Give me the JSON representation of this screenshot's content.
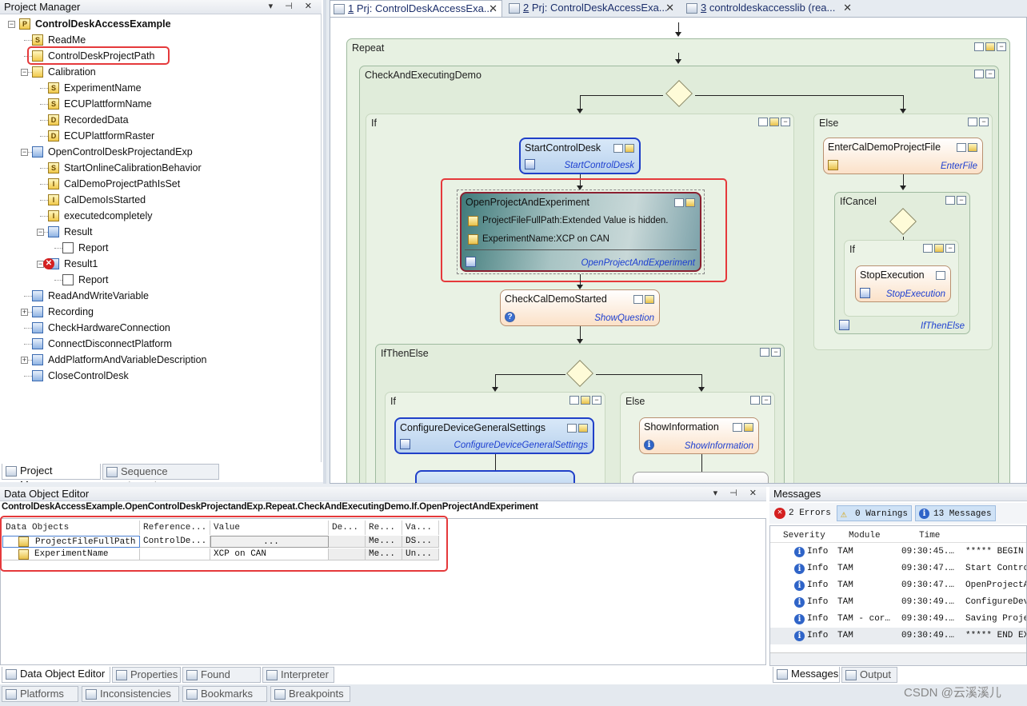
{
  "project_manager": {
    "title": "Project Manager",
    "pin_controls": "▾ ⊣ ✕",
    "tree": [
      {
        "label": "ControlDeskAccessExample",
        "bold": true,
        "icon": "project-icon",
        "depth": 0
      },
      {
        "label": "ReadMe",
        "icon": "string-icon",
        "depth": 1
      },
      {
        "label": "ControlDeskProjectPath",
        "icon": "file-icon",
        "depth": 1
      },
      {
        "label": "Calibration",
        "icon": "database-icon",
        "depth": 1
      },
      {
        "label": "ExperimentName",
        "icon": "string-icon",
        "depth": 2
      },
      {
        "label": "ECUPlattformName",
        "icon": "string-icon",
        "depth": 2
      },
      {
        "label": "RecordedData",
        "icon": "data-icon",
        "depth": 2
      },
      {
        "label": "ECUPlattformRaster",
        "icon": "data-icon",
        "depth": 2
      },
      {
        "label": "OpenControlDeskProjectandExp",
        "icon": "sequence-icon",
        "depth": 1
      },
      {
        "label": "StartOnlineCalibrationBehavior",
        "icon": "string-icon",
        "depth": 2
      },
      {
        "label": "CalDemoProjectPathIsSet",
        "icon": "int-icon",
        "depth": 2
      },
      {
        "label": "CalDemoIsStarted",
        "icon": "int-icon",
        "depth": 2
      },
      {
        "label": "executedcompletely",
        "icon": "int-icon",
        "depth": 2
      },
      {
        "label": "Result",
        "icon": "result-icon",
        "depth": 2
      },
      {
        "label": "Report",
        "icon": "report-icon",
        "depth": 3
      },
      {
        "label": "Result1",
        "icon": "result-error-icon",
        "depth": 2
      },
      {
        "label": "Report",
        "icon": "report-icon",
        "depth": 3
      },
      {
        "label": "ReadAndWriteVariable",
        "icon": "sequence-icon",
        "depth": 1
      },
      {
        "label": "Recording",
        "icon": "sequence-icon",
        "depth": 1
      },
      {
        "label": "CheckHardwareConnection",
        "icon": "sequence-icon",
        "depth": 1
      },
      {
        "label": "ConnectDisconnectPlatform",
        "icon": "sequence-icon",
        "depth": 1
      },
      {
        "label": "AddPlatformAndVariableDescription",
        "icon": "sequence-icon",
        "depth": 1
      },
      {
        "label": "CloseControlDesk",
        "icon": "sequence-icon",
        "depth": 1
      }
    ],
    "tabs": {
      "project_manager": "Project Manager",
      "sequence_hierarchy": "Sequence Hierarchy"
    }
  },
  "doc_tabs": [
    {
      "num": "1",
      "label": "Prj: ControlDeskAccessExa...",
      "close": "✕"
    },
    {
      "num": "2",
      "label": "Prj: ControlDeskAccessExa...",
      "close": "✕"
    },
    {
      "num": "3",
      "label": "controldeskaccesslib (rea...",
      "close": "✕"
    }
  ],
  "sequence": {
    "repeat": "Repeat",
    "check": "CheckAndExecutingDemo",
    "if1": "If",
    "else1": "Else",
    "start_title": "StartControlDesk",
    "start_link": "StartControlDesk",
    "open_title": "OpenProjectAndExperiment",
    "open_param1": "ProjectFileFullPath:Extended Value is hidden.",
    "open_param2": "ExperimentName:XCP on CAN",
    "open_link": "OpenProjectAndExperiment",
    "checkcal_title": "CheckCalDemoStarted",
    "checkcal_link": "ShowQuestion",
    "ifthenelse": "IfThenElse",
    "if2": "If",
    "else2": "Else",
    "config_title": "ConfigureDeviceGeneralSettings",
    "config_link": "ConfigureDeviceGeneralSettings",
    "showinfo_title": "ShowInformation",
    "showinfo_link": "ShowInformation",
    "enter_title": "EnterCalDemoProjectFile",
    "enter_link": "EnterFile",
    "ifcancel": "IfCancel",
    "if3": "If",
    "stop_title": "StopExecution",
    "stop_link": "StopExecution",
    "ifthenelse_link": "IfThenElse"
  },
  "data_object_editor": {
    "title": "Data Object Editor",
    "path": "ControlDeskAccessExample.OpenControlDeskProjectandExp.Repeat.CheckAndExecutingDemo.If.OpenProjectAndExperiment",
    "columns": [
      "Data Objects",
      "Reference...",
      "Value",
      "De...",
      "Re...",
      "Va..."
    ],
    "rows": [
      [
        "ProjectFileFullPath",
        "ControlDe...",
        "...",
        "",
        "Me...",
        "DS..."
      ],
      [
        "ExperimentName",
        "",
        "XCP on CAN",
        "",
        "Me...",
        "Un..."
      ]
    ],
    "tabs": [
      "Data Object Editor",
      "Properties",
      "Found items",
      "Interpreter"
    ]
  },
  "bottom_tabs": [
    "Platforms",
    "Inconsistencies",
    "Bookmarks",
    "Breakpoints"
  ],
  "messages": {
    "title": "Messages",
    "filters": {
      "errors": "2 Errors",
      "warnings": "0 Warnings",
      "messages": "13 Messages"
    },
    "columns": [
      "Severity",
      "Module",
      "Time"
    ],
    "rows": [
      {
        "severity": "Info",
        "module": "TAM",
        "time": "09:30:45.…",
        "text": "***** BEGIN E"
      },
      {
        "severity": "Info",
        "module": "TAM",
        "time": "09:30:47.…",
        "text": "Start Control"
      },
      {
        "severity": "Info",
        "module": "TAM",
        "time": "09:30:47.…",
        "text": "OpenProjectAn"
      },
      {
        "severity": "Info",
        "module": "TAM",
        "time": "09:30:49.…",
        "text": "ConfigureDevi"
      },
      {
        "severity": "Info",
        "module": "TAM - cor…",
        "time": "09:30:49.…",
        "text": "Saving Projec"
      },
      {
        "severity": "Info",
        "module": "TAM",
        "time": "09:30:49.…",
        "text": "***** END EXE"
      }
    ],
    "tabs": [
      "Messages",
      "Output"
    ]
  },
  "watermark": "CSDN @云溪溪儿"
}
